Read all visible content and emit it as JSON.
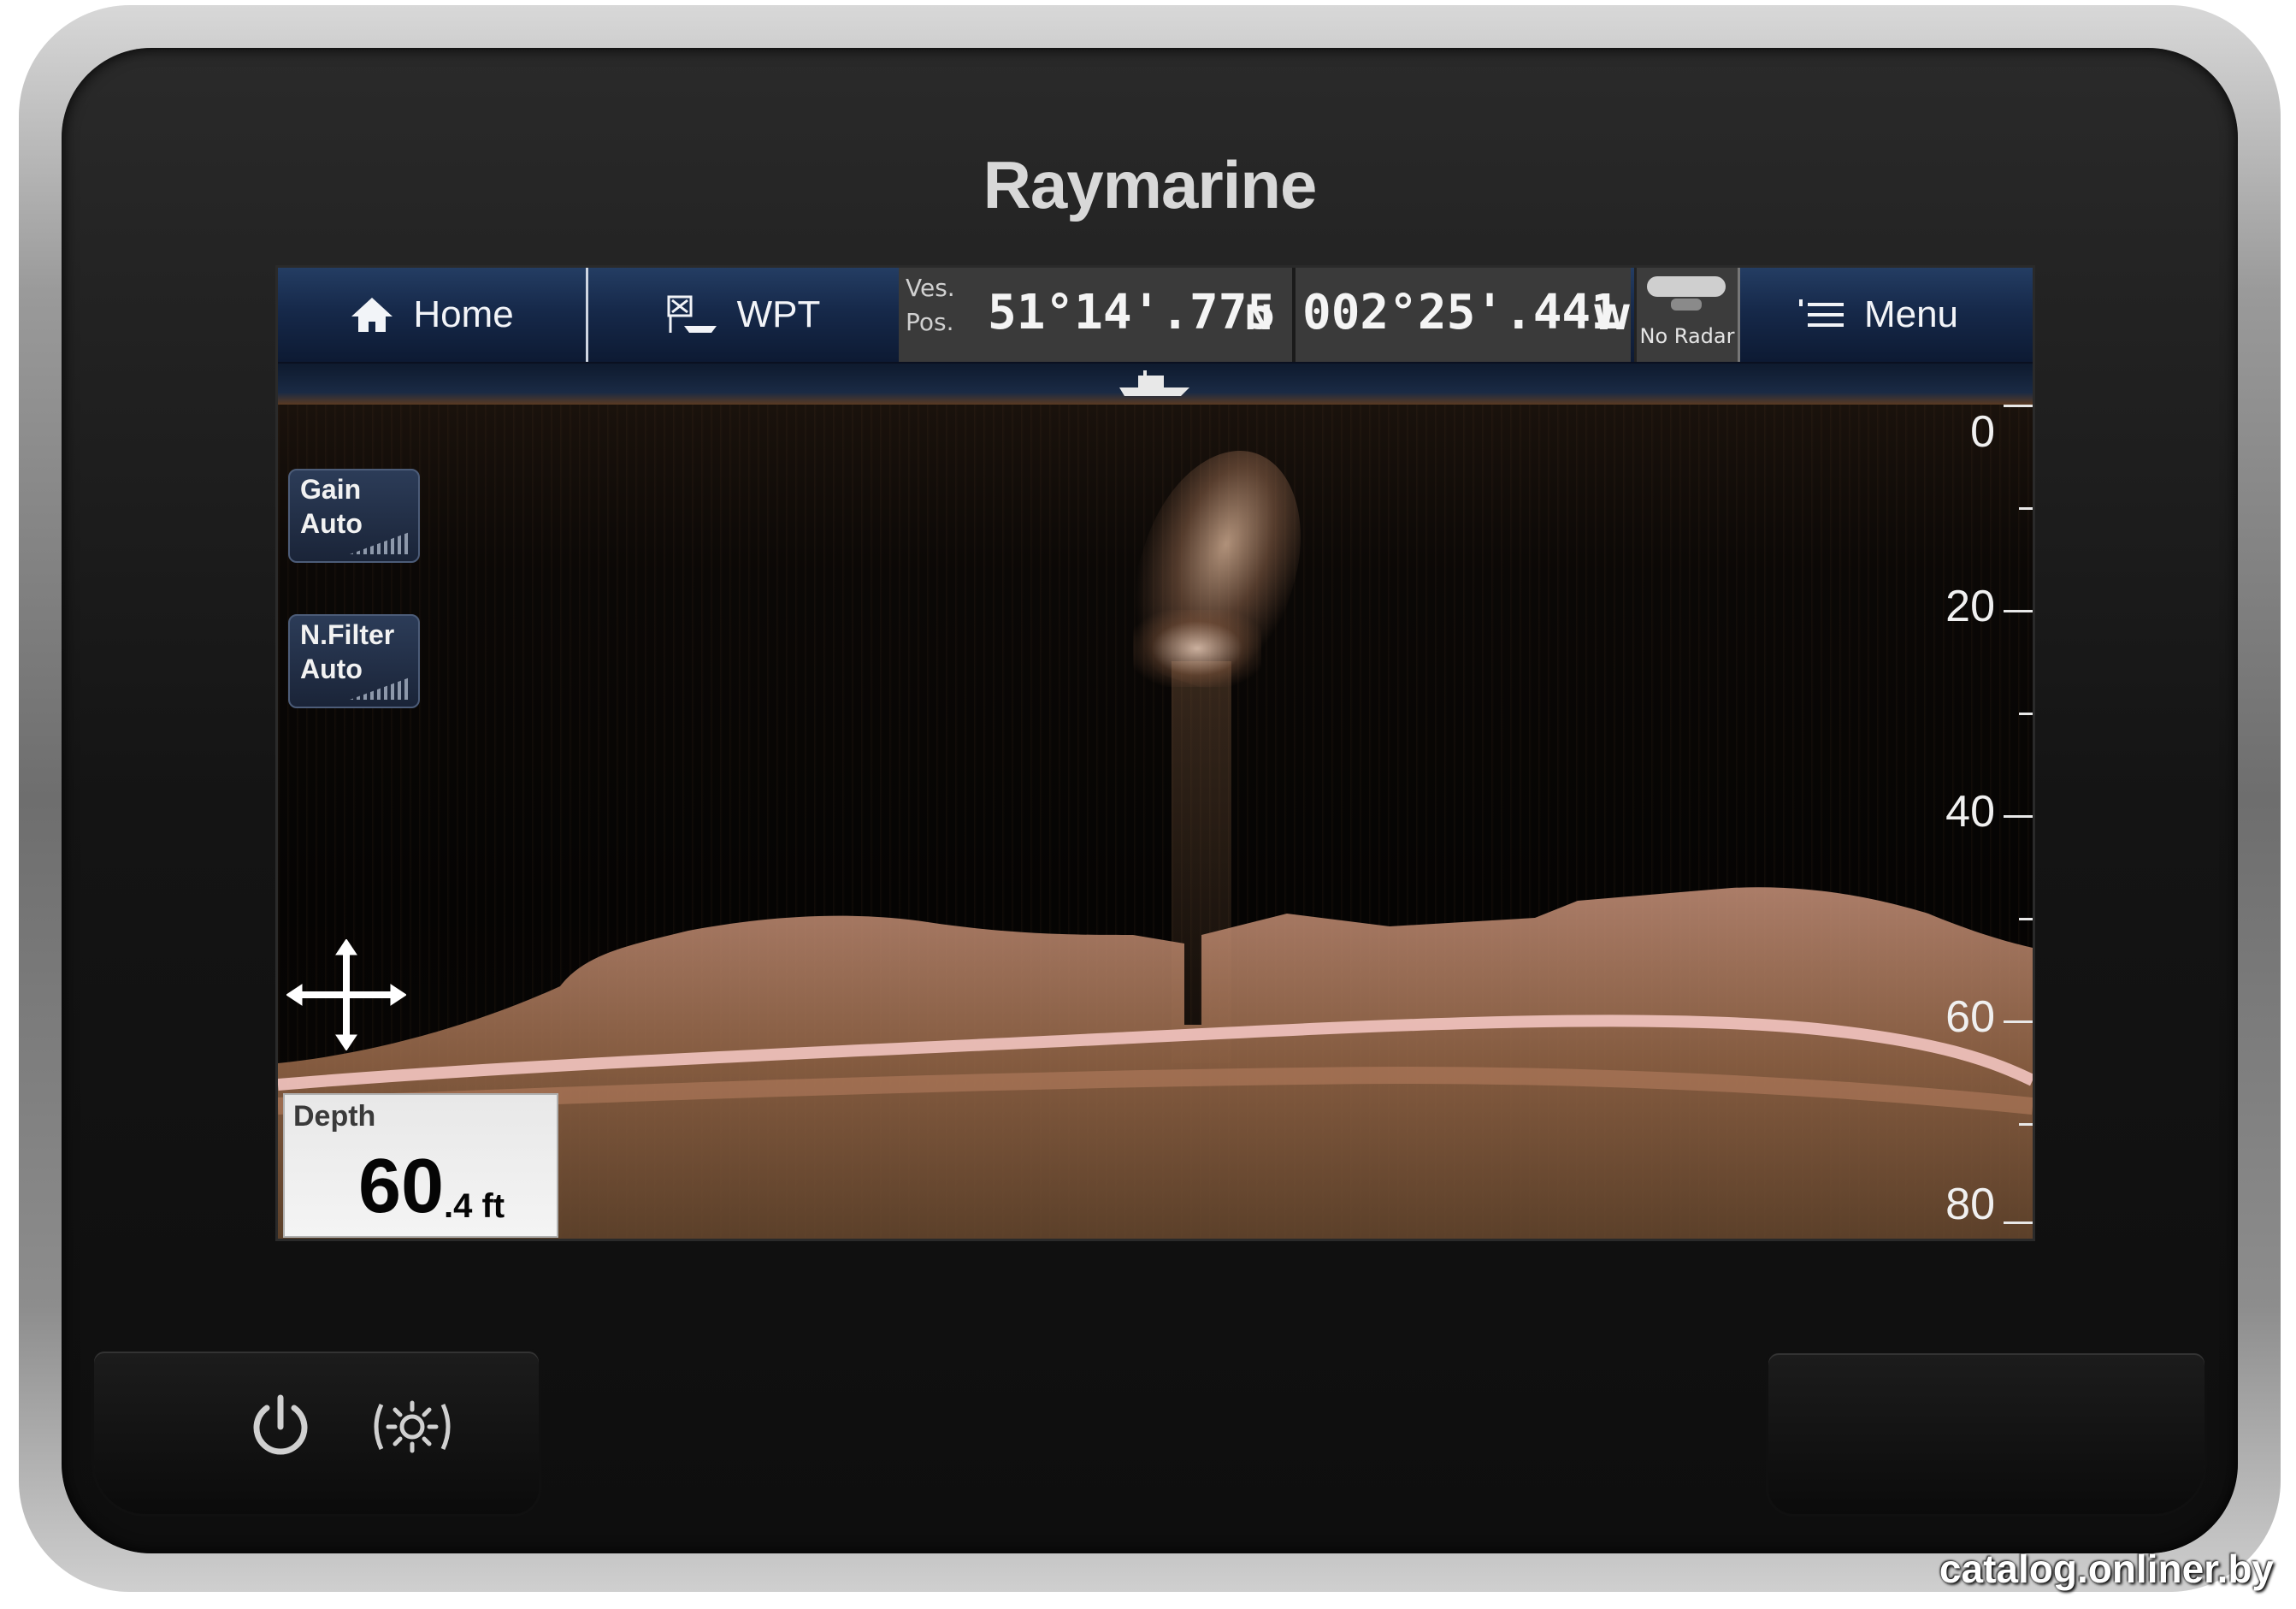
{
  "device": {
    "brand": "Raymarine"
  },
  "topbar": {
    "home_label": "Home",
    "wpt_label": "WPT",
    "pos_label_1": "Ves.",
    "pos_label_2": "Pos.",
    "latitude": "51°14'.775",
    "lat_hemisphere": "N",
    "longitude": "002°25'.441",
    "lon_hemisphere": "W",
    "radar_status": "No Radar",
    "menu_label": "Menu"
  },
  "controls": {
    "gain": {
      "line1": "Gain",
      "line2": "Auto"
    },
    "nfilter": {
      "line1": "N.Filter",
      "line2": "Auto"
    }
  },
  "depth_scale": [
    "0",
    "20",
    "40",
    "60",
    "80"
  ],
  "depth_readout": {
    "label": "Depth",
    "value_int": "60",
    "value_dec": ".4",
    "unit": "ft"
  },
  "watermark": "catalog.onliner.by",
  "colors": {
    "topbar": "#1a2d4f",
    "sonar_return": "#c8927a"
  },
  "icons": [
    "home-icon",
    "waypoint-icon",
    "radar-icon",
    "menu-icon",
    "pan-cross-icon",
    "power-icon",
    "brightness-icon",
    "boat-icon"
  ]
}
